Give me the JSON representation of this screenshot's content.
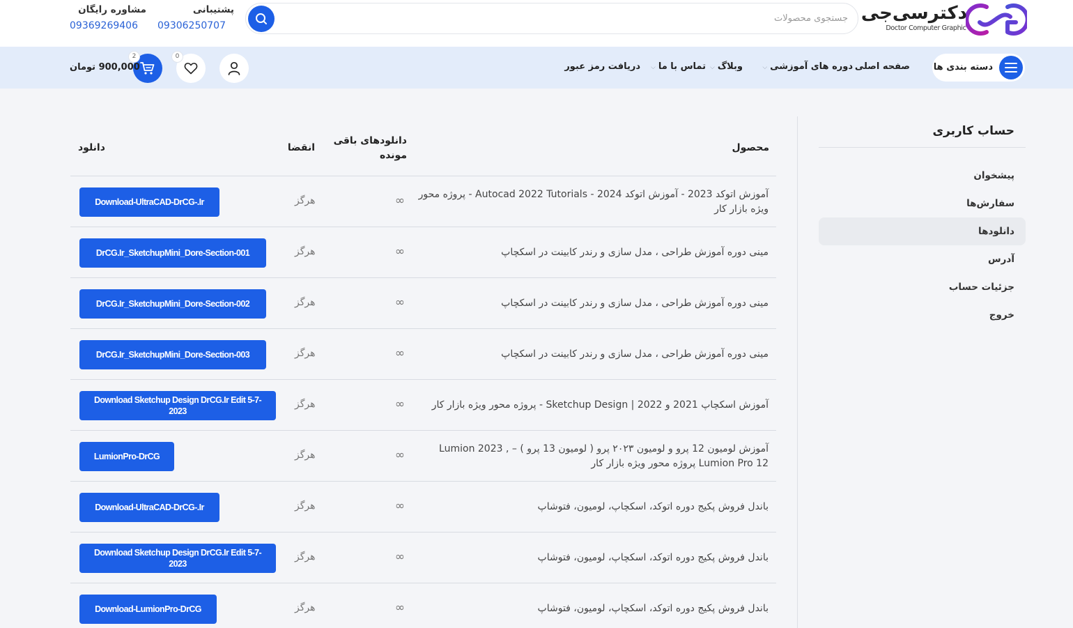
{
  "header": {
    "logo_fa": "دکترسی‌جی",
    "logo_en": "Doctor Computer Graphic",
    "search_placeholder": "جستجوی محصولات",
    "support_label": "پشتیبانی",
    "support_phone": "09306250707",
    "consult_label": "مشاوره رایگان",
    "consult_phone": "09369269406"
  },
  "nav": {
    "categories_label": "دسته بندی ها",
    "items": [
      "صفحه اصلی",
      "دوره های آموزشی",
      "وبلاگ",
      "تماس با ما",
      "دریافت رمز عبور"
    ],
    "cart_total": "900,000 تومان",
    "cart_count": "2",
    "wishlist_count": "0"
  },
  "sidebar": {
    "title": "حساب کاربری",
    "items": [
      "پیشخوان",
      "سفارش‌ها",
      "دانلودها",
      "آدرس",
      "جزئیات حساب",
      "خروج"
    ]
  },
  "table": {
    "headers": {
      "product": "محصول",
      "remaining": "دانلودهای باقی مونده",
      "expiry": "انقضا",
      "download": "دانلود"
    },
    "rows": [
      {
        "product": "آموزش اتوکد 2023 - آموزش اتوکد 2024 - Autocad 2022 Tutorials - پروژه محور ویژه بازار کار",
        "remaining": "∞",
        "expiry": "هرگز",
        "download": "Download-UltraCAD-DrCG-.Ir"
      },
      {
        "product": "مینی دوره آموزش طراحی ، مدل سازی و رندر کابینت در اسکچاپ",
        "remaining": "∞",
        "expiry": "هرگز",
        "download": "DrCG.Ir_SketchupMini_Dore-Section-001"
      },
      {
        "product": "مینی دوره آموزش طراحی ، مدل سازی و رندر کابینت در اسکچاپ",
        "remaining": "∞",
        "expiry": "هرگز",
        "download": "DrCG.Ir_SketchupMini_Dore-Section-002"
      },
      {
        "product": "مینی دوره آموزش طراحی ، مدل سازی و رندر کابینت در اسکچاپ",
        "remaining": "∞",
        "expiry": "هرگز",
        "download": "DrCG.Ir_SketchupMini_Dore-Section-003"
      },
      {
        "product": "آموزش اسکچاپ 2021 و 2022 | Sketchup Design - پروژه محور ویژه بازار کار",
        "remaining": "∞",
        "expiry": "هرگز",
        "download": "Download Sketchup Design DrCG.Ir Edit 5-7-2023"
      },
      {
        "product": "آموزش لومیون 12 پرو و لومیون ۲۰۲۳ پرو ( لومیون 13 پرو ) – , Lumion 2023 Lumion Pro 12 پروژه محور ویژه بازار کار",
        "remaining": "∞",
        "expiry": "هرگز",
        "download": "LumionPro-DrCG"
      },
      {
        "product": "باندل فروش پکیج دوره اتوکد، اسکچاپ، لومیون، فتوشاپ",
        "remaining": "∞",
        "expiry": "هرگز",
        "download": "Download-UltraCAD-DrCG-.Ir"
      },
      {
        "product": "باندل فروش پکیج دوره اتوکد، اسکچاپ، لومیون، فتوشاپ",
        "remaining": "∞",
        "expiry": "هرگز",
        "download": "Download Sketchup Design DrCG.Ir Edit 5-7-2023"
      },
      {
        "product": "باندل فروش پکیج دوره اتوکد، اسکچاپ، لومیون، فتوشاپ",
        "remaining": "∞",
        "expiry": "هرگز",
        "download": "Download-LumionPro-DrCG"
      }
    ]
  },
  "colors": {
    "accent": "#1d5fe6",
    "nav_bg": "#e3ecfa",
    "page_bg": "#f4f5f8",
    "phone": "#2a62d6"
  },
  "icons": {
    "logo": "dcg-logo-icon",
    "search": "search-icon",
    "menu": "hamburger-icon",
    "user": "user-icon",
    "wishlist": "heart-icon",
    "cart": "cart-icon"
  }
}
